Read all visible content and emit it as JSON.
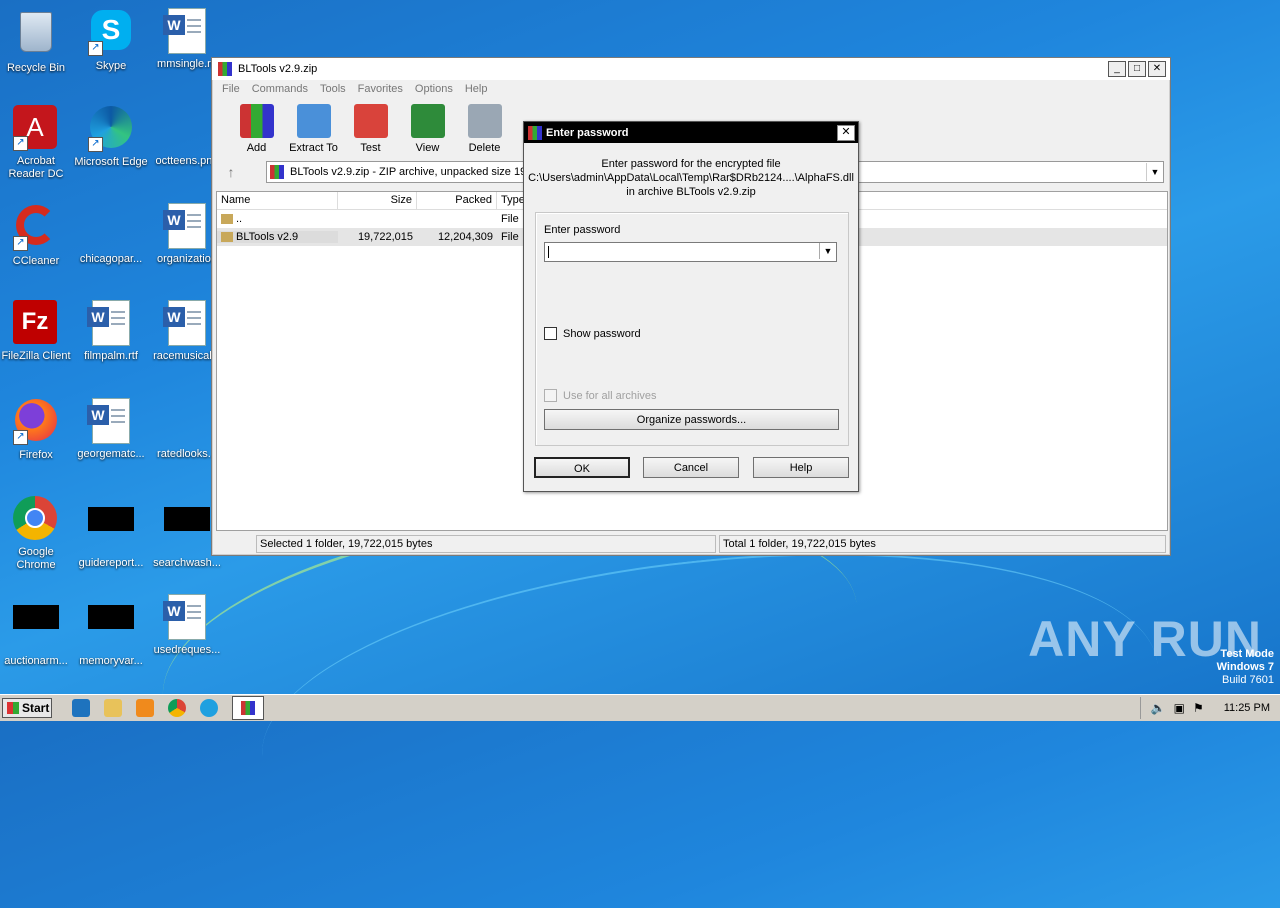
{
  "desktop": {
    "icons": [
      {
        "label": "Recycle Bin"
      },
      {
        "label": "Skype"
      },
      {
        "label": "mmsingle.rtf"
      },
      {
        "label": "Acrobat Reader DC"
      },
      {
        "label": "Microsoft Edge"
      },
      {
        "label": "octteens.png"
      },
      {
        "label": "CCleaner"
      },
      {
        "label": "chicagopar..."
      },
      {
        "label": "organization"
      },
      {
        "label": "FileZilla Client"
      },
      {
        "label": "filmpalm.rtf"
      },
      {
        "label": "racemusical..."
      },
      {
        "label": "Firefox"
      },
      {
        "label": "georgematc..."
      },
      {
        "label": "ratedlooks..."
      },
      {
        "label": "Google Chrome"
      },
      {
        "label": "guidereport..."
      },
      {
        "label": "searchwash..."
      },
      {
        "label": "auctionarm..."
      },
      {
        "label": "memoryvar..."
      },
      {
        "label": "usedreques..."
      }
    ],
    "watermark": "ANY RUN",
    "test_mode": {
      "line1": "Test Mode",
      "line2": "Windows 7",
      "line3": "Build 7601"
    }
  },
  "window": {
    "title": "BLTools v2.9.zip",
    "menu": [
      "File",
      "Commands",
      "Tools",
      "Favorites",
      "Options",
      "Help"
    ],
    "toolbar": [
      "Add",
      "Extract To",
      "Test",
      "View",
      "Delete"
    ],
    "address": "BLTools v2.9.zip - ZIP archive, unpacked size 19",
    "columns": [
      "Name",
      "Size",
      "Packed",
      "Type"
    ],
    "rows": [
      {
        "name": "..",
        "size": "",
        "packed": "",
        "type": "File"
      },
      {
        "name": "BLTools v2.9",
        "size": "19,722,015",
        "packed": "12,204,309",
        "type": "File"
      }
    ],
    "status_left": "Selected 1 folder, 19,722,015 bytes",
    "status_right": "Total 1 folder, 19,722,015 bytes"
  },
  "dialog": {
    "title": "Enter password",
    "info_line1": "Enter password for the encrypted file",
    "info_line2": "C:\\Users\\admin\\AppData\\Local\\Temp\\Rar$DRb2124....\\AlphaFS.dll",
    "info_line3": "in archive BLTools v2.9.zip",
    "password_label": "Enter password",
    "password_value": "",
    "show_password": "Show password",
    "use_all_archives": "Use for all archives",
    "organize_button": "Organize passwords...",
    "ok": "OK",
    "cancel": "Cancel",
    "help": "Help"
  },
  "taskbar": {
    "start": "Start",
    "clock": "11:25 PM"
  },
  "colors": {
    "desktop": "#1f86dd",
    "dialog_title": "#000000"
  }
}
